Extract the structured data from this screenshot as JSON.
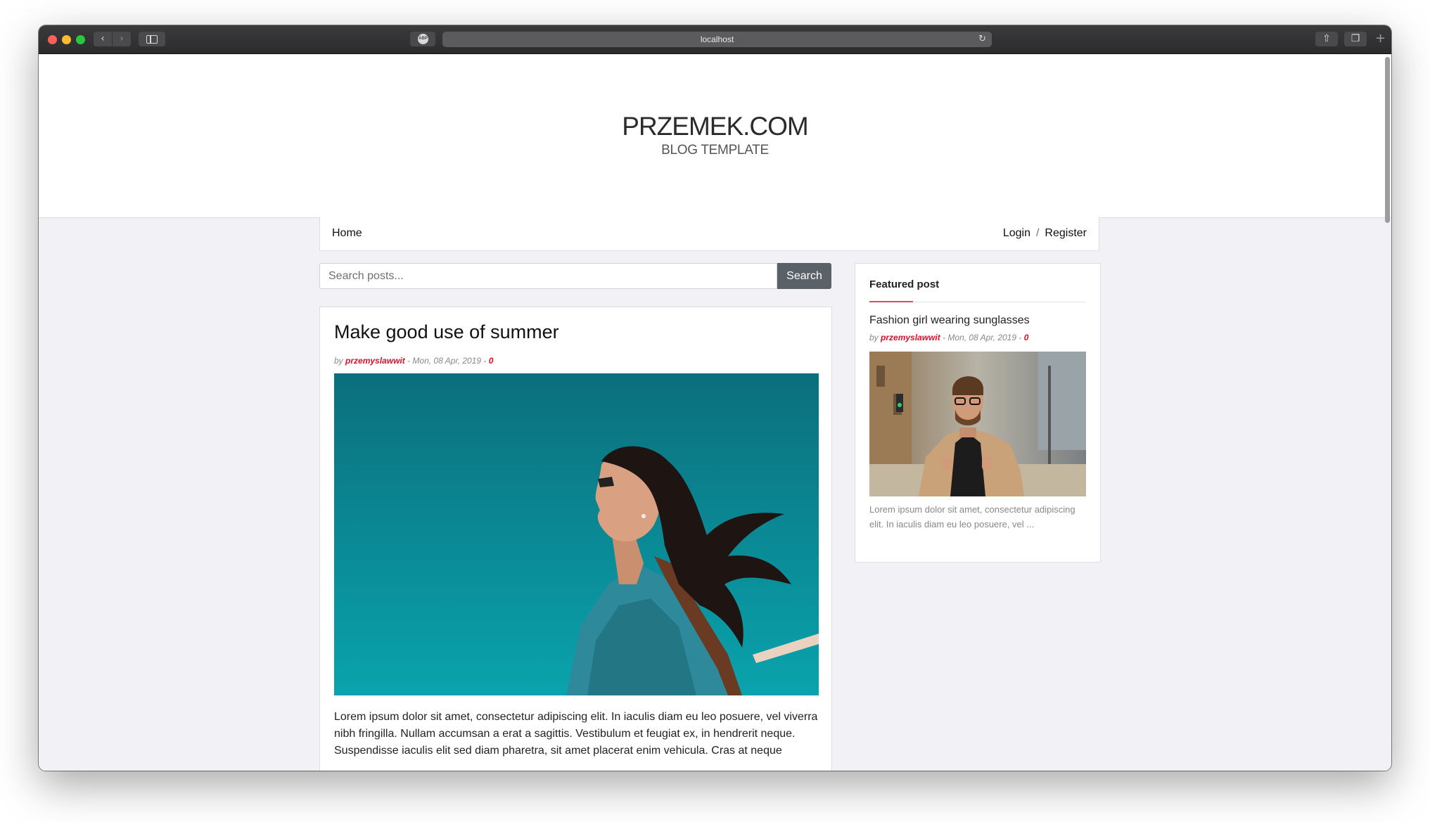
{
  "browser": {
    "url": "localhost",
    "abp_label": "ABP"
  },
  "site": {
    "title": "PRZEMEK.COM",
    "subtitle": "BLOG TEMPLATE"
  },
  "nav": {
    "home": "Home",
    "login": "Login",
    "separator": "/",
    "register": "Register"
  },
  "search": {
    "placeholder": "Search posts...",
    "button": "Search"
  },
  "post": {
    "title": "Make good use of summer",
    "by": "by",
    "author": "przemyslawwit",
    "date": "- Mon, 08 Apr, 2019 -",
    "comments": "0",
    "body": "Lorem ipsum dolor sit amet, consectetur adipiscing elit. In iaculis diam eu leo posuere, vel viverra nibh fringilla. Nullam accumsan a erat a sagittis. Vestibulum et feugiat ex, in hendrerit neque. Suspendisse iaculis elit sed diam pharetra, sit amet placerat enim vehicula. Cras at neque"
  },
  "featured": {
    "heading": "Featured post",
    "title": "Fashion girl wearing sunglasses",
    "by": "by",
    "author": "przemyslawwit",
    "date": "- Mon, 08 Apr, 2019 -",
    "comments": "0",
    "excerpt": "Lorem ipsum dolor sit amet, consectetur adipiscing elit. In iaculis diam eu leo posuere, vel ..."
  },
  "colors": {
    "accent": "#d9112c",
    "search_button": "#5a6169",
    "page_background": "#f2f2f6"
  }
}
